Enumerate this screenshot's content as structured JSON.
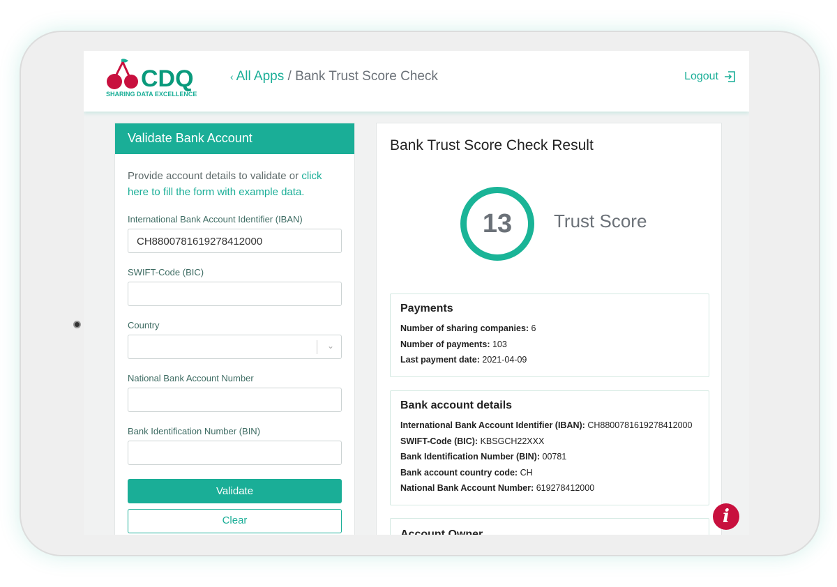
{
  "header": {
    "logo_text": "CDQ",
    "logo_tagline": "SHARING DATA EXCELLENCE",
    "back_link": "All Apps",
    "separator": "/",
    "page": "Bank Trust Score Check",
    "logout": "Logout"
  },
  "form": {
    "title": "Validate Bank Account",
    "intro": "Provide account details to validate or ",
    "intro_link": "click here to fill the form with example data.",
    "fields": [
      {
        "label": "International Bank Account Identifier (IBAN)",
        "value": "CH8800781619278412000"
      },
      {
        "label": "SWIFT-Code (BIC)",
        "value": ""
      },
      {
        "label": "Country",
        "value": ""
      },
      {
        "label": "National Bank Account Number",
        "value": ""
      },
      {
        "label": "Bank Identification Number (BIN)",
        "value": ""
      }
    ],
    "validate": "Validate",
    "clear": "Clear"
  },
  "result": {
    "title": "Bank Trust Score Check Result",
    "score": "13",
    "score_label": "Trust Score",
    "payments": {
      "title": "Payments",
      "rows": [
        {
          "k": "Number of sharing companies:",
          "v": "6"
        },
        {
          "k": "Number of payments:",
          "v": "103"
        },
        {
          "k": "Last payment date:",
          "v": "2021-04-09"
        }
      ]
    },
    "bank": {
      "title": "Bank account details",
      "rows": [
        {
          "k": "International Bank Account Identifier (IBAN):",
          "v": "CH8800781619278412000"
        },
        {
          "k": "SWIFT-Code (BIC):",
          "v": "KBSGCH22XXX"
        },
        {
          "k": "Bank Identification Number (BIN):",
          "v": "00781"
        },
        {
          "k": "Bank account country code:",
          "v": "CH"
        },
        {
          "k": "National Bank Account Number:",
          "v": "619278412000"
        }
      ]
    },
    "owner": {
      "title": "Account Owner"
    }
  },
  "colors": {
    "accent": "#1aae97",
    "brand_red": "#c8103e"
  }
}
